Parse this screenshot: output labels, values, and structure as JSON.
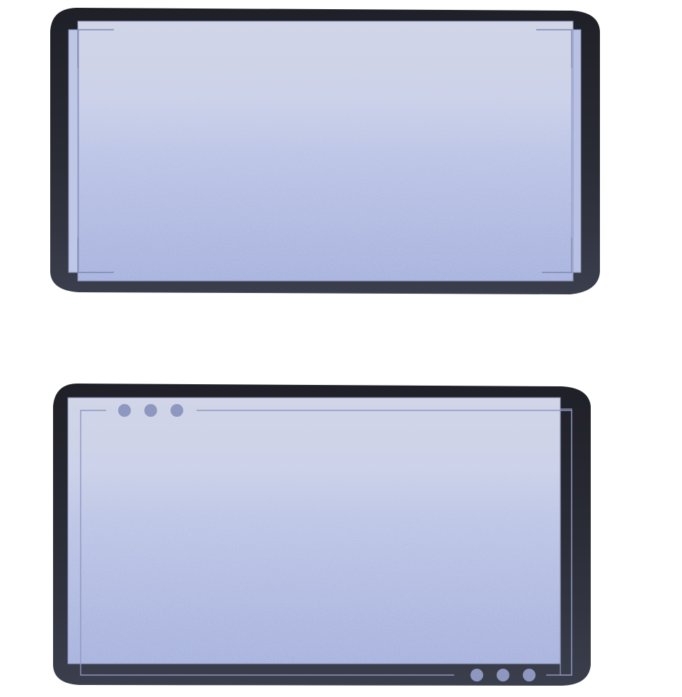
{
  "frames": [
    {
      "id": "frame-a",
      "style": "corner-brackets",
      "dot_count": 0
    },
    {
      "id": "frame-b",
      "style": "offset-border-with-dots",
      "dot_count": 6
    }
  ],
  "colors": {
    "bezel_dark": "#22242c",
    "bezel_mid": "#3a3d4a",
    "screen_top": "#d1d5e7",
    "screen_bottom": "#a9b4df",
    "accent_line": "#8e97bf",
    "dot": "#8e97bf"
  }
}
